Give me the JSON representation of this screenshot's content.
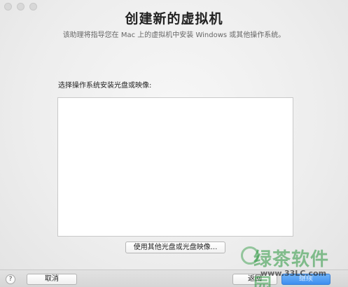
{
  "window": {
    "title": "创建新的虚拟机",
    "subtitle": "该助理将指导您在 Mac 上的虚拟机中安装 Windows 或其他操作系统。"
  },
  "main": {
    "section_label": "选择操作系统安装光盘或映像:",
    "other_media_button": "使用其他光盘或光盘映像..."
  },
  "footer": {
    "help_label": "?",
    "cancel_label": "取消",
    "back_label": "返回",
    "continue_label": "继续"
  },
  "watermark": {
    "logo_text": "绿茶软件园",
    "url": "www.33LC.com"
  },
  "colors": {
    "primary_button": "#3d8ef0"
  }
}
